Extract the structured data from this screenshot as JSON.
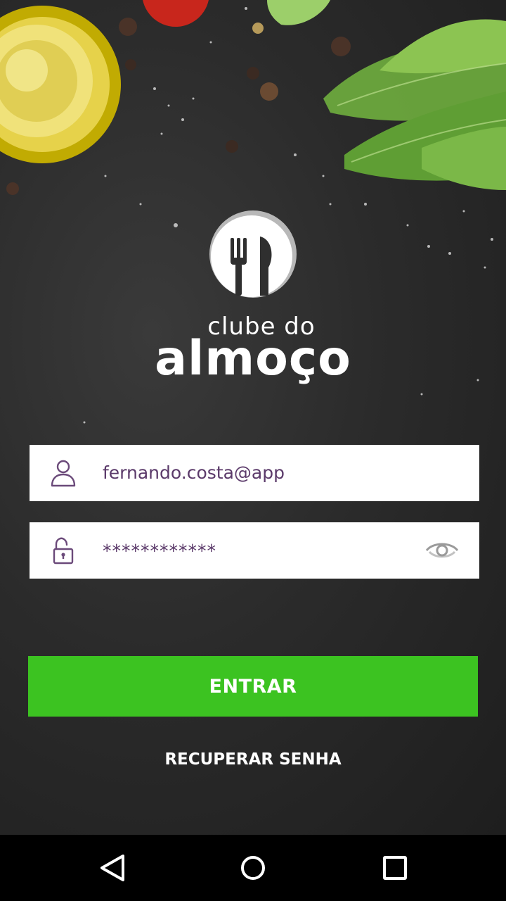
{
  "brand": {
    "line1": "clube do",
    "line2": "almoço"
  },
  "login": {
    "email_value": "fernando.costa@app",
    "password_value": "************",
    "submit_label": "ENTRAR",
    "recover_label": "RECUPERAR SENHA"
  },
  "icons": {
    "email": "user-icon",
    "password": "unlock-icon",
    "toggle": "eye-icon",
    "logo": "fork-knife-icon"
  },
  "colors": {
    "accent": "#3cc321",
    "field_text": "#5b3a6a",
    "icon": "#6b4a7a",
    "background": "#2b2b2b"
  }
}
